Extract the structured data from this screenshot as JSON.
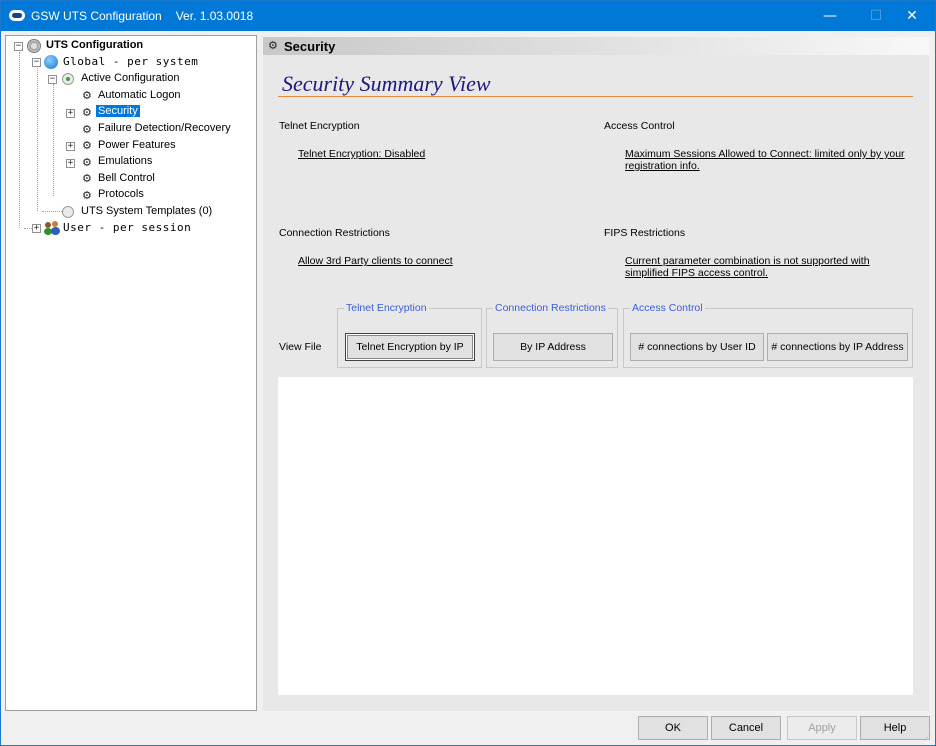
{
  "window": {
    "title": "GSW UTS Configuration",
    "version": "Ver. 1.03.0018",
    "min_glyph": "—",
    "max_glyph": "☐",
    "close_glyph": "✕"
  },
  "tree": {
    "root": "UTS Configuration",
    "global": "Global  -  per system",
    "active_config": "Active Configuration",
    "items": [
      {
        "label": "Automatic Logon"
      },
      {
        "label": "Security",
        "selected": true
      },
      {
        "label": "Failure Detection/Recovery"
      },
      {
        "label": "Power Features"
      },
      {
        "label": "Emulations"
      },
      {
        "label": "Bell Control"
      },
      {
        "label": "Protocols"
      }
    ],
    "templates": "UTS System Templates (0)",
    "user": "User   -  per session",
    "expand_glyph": "+",
    "collapse_glyph": "−"
  },
  "content": {
    "header": "Security",
    "summary_title": "Security Summary View",
    "telnet_label": "Telnet Encryption",
    "telnet_link": "Telnet Encryption: Disabled",
    "access_label": "Access Control",
    "access_link": "Maximum Sessions Allowed to Connect: limited only by your registration info.",
    "conn_label": "Connection Restrictions",
    "conn_link": "Allow 3rd Party clients to connect",
    "fips_label": "FIPS Restrictions",
    "fips_link": "Current parameter combination is not supported with simplified FIPS access control.",
    "view_file": "View File",
    "groups": {
      "telnet": {
        "legend": "Telnet Encryption",
        "button": "Telnet Encryption by IP"
      },
      "conn": {
        "legend": "Connection Restrictions",
        "button": "By IP Address"
      },
      "access": {
        "legend": "Access Control",
        "button1": "# connections by User ID",
        "button2": "# connections by IP Address"
      }
    }
  },
  "footer": {
    "ok": "OK",
    "cancel": "Cancel",
    "apply": "Apply",
    "help": "Help"
  },
  "colors": {
    "titlebar": "#0078d7",
    "selection": "#0078d7",
    "summary_title": "#1a1a7a",
    "rule": "#e58a3a",
    "legend": "#3a5fd9"
  }
}
